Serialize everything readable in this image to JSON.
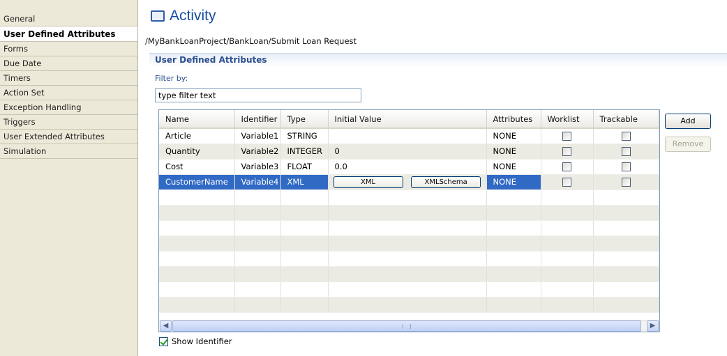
{
  "sidebar": {
    "items": [
      {
        "label": "General"
      },
      {
        "label": "User Defined Attributes",
        "selected": true
      },
      {
        "label": "Forms"
      },
      {
        "label": "Due Date"
      },
      {
        "label": "Timers"
      },
      {
        "label": "Action Set"
      },
      {
        "label": "Exception Handling"
      },
      {
        "label": "Triggers"
      },
      {
        "label": "User Extended Attributes"
      },
      {
        "label": "Simulation"
      }
    ]
  },
  "header": {
    "title": "Activity",
    "path": "/MyBankLoanProject/BankLoan/Submit Loan Request"
  },
  "section": {
    "title": "User Defined Attributes",
    "filter_label": "Filter by:",
    "filter_value": "type filter text"
  },
  "table": {
    "columns": [
      "Name",
      "Identifier",
      "Type",
      "Initial Value",
      "Attributes",
      "Worklist",
      "Trackable"
    ],
    "rows": [
      {
        "name": "Article",
        "identifier": "Variable1",
        "type": "STRING",
        "initial_value": "",
        "attributes": "NONE",
        "worklist": false,
        "trackable": false
      },
      {
        "name": "Quantity",
        "identifier": "Variable2",
        "type": "INTEGER",
        "initial_value": "0",
        "attributes": "NONE",
        "worklist": false,
        "trackable": false
      },
      {
        "name": "Cost",
        "identifier": "Variable3",
        "type": "FLOAT",
        "initial_value": "0.0",
        "attributes": "NONE",
        "worklist": false,
        "trackable": false
      },
      {
        "name": "CustomerName",
        "identifier": "Variable4",
        "type": "XML",
        "initial_value": "",
        "attributes": "NONE",
        "worklist": false,
        "trackable": false,
        "selected": true,
        "buttons": {
          "xml": "XML",
          "schema": "XMLSchema"
        }
      }
    ]
  },
  "buttons": {
    "add": "Add",
    "remove": "Remove"
  },
  "show_identifier": {
    "label": "Show Identifier",
    "checked": true
  },
  "colors": {
    "selection": "#316ac5",
    "title": "#154ea2",
    "section_title": "#2a4f8f"
  }
}
